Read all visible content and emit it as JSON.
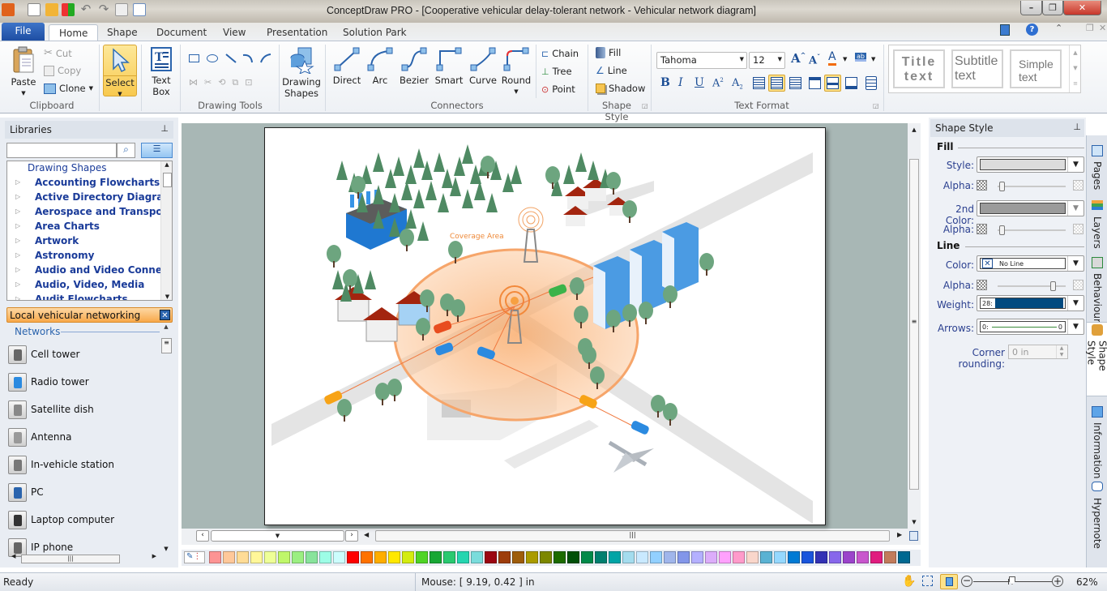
{
  "window": {
    "title": "ConceptDraw PRO - [Cooperative vehicular delay-tolerant network - Vehicular network diagram]"
  },
  "quick_access": [
    "app-menu",
    "new",
    "open",
    "solution-browser",
    "undo",
    "redo",
    "save",
    "print-preview"
  ],
  "tabs": {
    "file": "File",
    "items": [
      "Home",
      "Shape",
      "Document",
      "View",
      "Presentation",
      "Solution Park"
    ],
    "active": "Home"
  },
  "ribbon": {
    "clipboard": {
      "paste": "Paste",
      "cut": "Cut",
      "copy": "Copy",
      "clone": "Clone",
      "label": "Clipboard"
    },
    "select": {
      "label": "Select"
    },
    "textbox": {
      "line1": "Text",
      "line2": "Box"
    },
    "drawing_tools": {
      "label": "Drawing Tools"
    },
    "drawing_shapes": {
      "line1": "Drawing",
      "line2": "Shapes"
    },
    "connectors": {
      "items": [
        "Direct",
        "Arc",
        "Bezier",
        "Smart",
        "Curve",
        "Round"
      ],
      "chain": "Chain",
      "tree": "Tree",
      "point": "Point",
      "label": "Connectors"
    },
    "shape_style": {
      "fill": "Fill",
      "line": "Line",
      "shadow": "Shadow",
      "label": "Shape Style"
    },
    "text_format": {
      "font": "Tahoma",
      "size": "12",
      "label": "Text Format"
    },
    "text_styles": {
      "title": [
        "Title",
        "text"
      ],
      "subtitle": [
        "Subtitle",
        "text"
      ],
      "simple": [
        "Simple",
        "text"
      ]
    }
  },
  "libraries": {
    "header": "Libraries",
    "search_placeholder": "",
    "tree": [
      "Drawing Shapes",
      "Accounting Flowcharts",
      "Active Directory Diagrams",
      "Aerospace and Transport",
      "Area Charts",
      "Artwork",
      "Astronomy",
      "Audio and Video Connectors",
      "Audio, Video, Media",
      "Audit Flowcharts"
    ],
    "active_library": "Local vehicular networking",
    "section": "Networks",
    "items": [
      "Cell tower",
      "Radio tower",
      "Satellite dish",
      "Antenna",
      "In-vehicle station",
      "PC",
      "Laptop computer",
      "IP phone"
    ]
  },
  "diagram": {
    "coverage_label": "Coverage Area"
  },
  "shape_style_panel": {
    "header": "Shape Style",
    "fill_heading": "Fill",
    "style_label": "Style:",
    "alpha_label": "Alpha:",
    "second_color_label": "2nd Color:",
    "line_heading": "Line",
    "color_label": "Color:",
    "color_value": "No Line",
    "weight_label": "Weight:",
    "weight_value": "28:",
    "arrows_label": "Arrows:",
    "arrows_value_left": "0:",
    "arrows_value_right": "0",
    "corner_label": "Corner rounding:",
    "corner_value": "0 in",
    "fill_style_color": "#dcdcdc",
    "second_color": "#9b9b9b",
    "weight_color": "#024a80",
    "fill_alpha": 0.02,
    "second_alpha": 0.02,
    "line_alpha": 0.85
  },
  "side_tabs": [
    "Pages",
    "Layers",
    "Behaviour",
    "Shape Style",
    "Information",
    "Hypernote"
  ],
  "palette": [
    "#fd9494",
    "#ffc89a",
    "#ffdc96",
    "#fff799",
    "#eeff97",
    "#bff76a",
    "#9bef82",
    "#88e39c",
    "#9dfde6",
    "#ccfdfd",
    "#fe0000",
    "#ff7200",
    "#ffae00",
    "#ffe800",
    "#d3ec10",
    "#4fd426",
    "#18a735",
    "#29c970",
    "#25d5b0",
    "#7adcdc",
    "#9b0612",
    "#9d3d0c",
    "#9e5d0b",
    "#aa9b00",
    "#7c8700",
    "#1c6b00",
    "#004f09",
    "#008949",
    "#007f6f",
    "#00a4a6",
    "#a4dcee",
    "#c9e9ff",
    "#92d0ff",
    "#a0b6eb",
    "#8296e9",
    "#b4b0ff",
    "#dcadfa",
    "#ffa1fd",
    "#ff9bcb",
    "#f9d6cb",
    "#5ab2d3",
    "#95d8ff",
    "#007ad4",
    "#1954dc",
    "#3332b5",
    "#8767eb",
    "#9b44cb",
    "#c856cd",
    "#e01c7f",
    "#c27c5c",
    "#006891"
  ],
  "status": {
    "ready": "Ready",
    "mouse": "Mouse: [ 9.19, 0.42 ] in",
    "zoom": "62%",
    "zoom_level": 0.62
  }
}
